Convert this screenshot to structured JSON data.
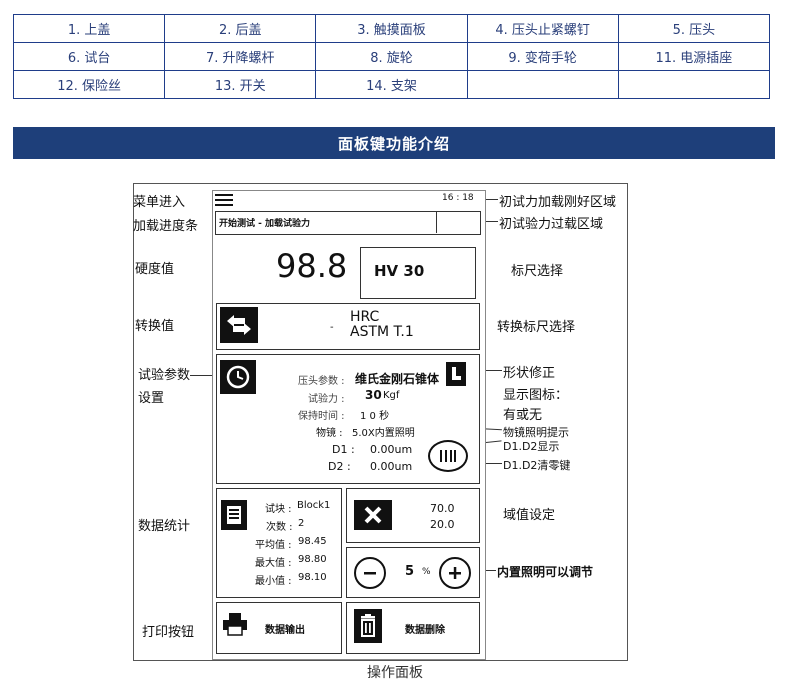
{
  "parts_table": {
    "rows": [
      [
        "1. 上盖",
        "2. 后盖",
        "3. 触摸面板",
        "4. 压头止紧螺钉",
        "5. 压头"
      ],
      [
        "6. 试台",
        "7. 升降螺杆",
        "8. 旋轮",
        "9. 变荷手轮",
        "11. 电源插座"
      ],
      [
        "12. 保险丝",
        "13. 开关",
        "14. 支架",
        "",
        ""
      ]
    ]
  },
  "banner": {
    "title": "面板键功能介绍"
  },
  "left_annotations": {
    "menu": "菜单进入",
    "progress": "加载进度条",
    "hardness": "硬度值",
    "convert": "转换值",
    "params_line1": "试验参数",
    "params_line2": "设置",
    "stats": "数据统计",
    "print": "打印按钮"
  },
  "right_annotations": {
    "preload_ok": "初试力加载刚好区域",
    "preload_over": "初试验力过载区域",
    "scale_select": "标尺选择",
    "convert_select": "转换标尺选择",
    "shape_fix": "形状修正",
    "show_icon": "显示图标：",
    "yes_no": "有或无",
    "lens_light": "物镜照明提示",
    "d1d2_show": "D1.D2显示",
    "d1d2_clear": "D1.D2清零键",
    "threshold": "域值设定",
    "light_adjust": "内置照明可以调节"
  },
  "screen": {
    "time": "16 : 18",
    "status": "开始测试 - 加载试验力",
    "hardness_value": "98.8",
    "scale": "HV 30",
    "convert_scale": "HRC",
    "convert_standard": "ASTM T.1",
    "convert_dash": "-",
    "params": {
      "indenter_label": "压头参数 :",
      "indenter_value": "维氏金刚石锥体",
      "force_label": "试验力 :",
      "force_value": "30",
      "force_unit": "Kgf",
      "hold_label": "保持时间 :",
      "hold_value": "1 0 秒",
      "lens_label": "物镜 :",
      "lens_value": "5.0X内置照明",
      "d1_label": "D1 :",
      "d1_value": "0.00um",
      "d2_label": "D2 :",
      "d2_value": "0.00um"
    },
    "stats": {
      "block_label": "试块 :",
      "block_value": "Block1",
      "count_label": "次数 :",
      "count_value": "2",
      "avg_label": "平均值 :",
      "avg_value": "98.45",
      "max_label": "最大值 :",
      "max_value": "98.80",
      "min_label": "最小值 :",
      "min_value": "98.10"
    },
    "threshold": {
      "upper": "70.0",
      "lower": "20.0"
    },
    "light": {
      "value": "5",
      "unit": "%"
    },
    "print_label": "数据输出",
    "delete_label": "数据删除"
  },
  "caption": "操作面板"
}
